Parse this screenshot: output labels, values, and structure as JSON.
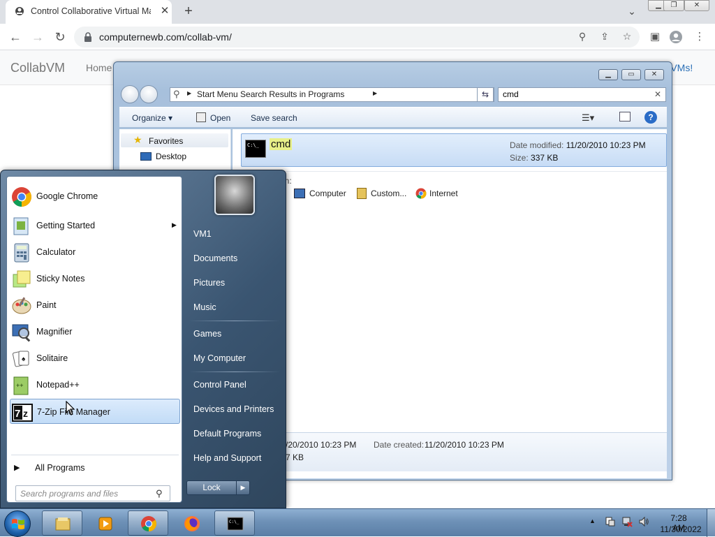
{
  "browser": {
    "tab_title": "Control Collaborative Virtual Ma",
    "tab_close": "✕",
    "new_tab": "+",
    "url": "computernewb.com/collab-vm/",
    "window_controls": {
      "minimize": "▁",
      "restore": "❐",
      "close": "✕"
    }
  },
  "site": {
    "brand": "CollabVM",
    "nav_home": "Home",
    "nav_more": "re VMs!"
  },
  "explorer": {
    "address": "Start Menu Search Results in Programs",
    "search_value": "cmd",
    "search_clear": "✕",
    "toolbar": {
      "organize": "Organize ▾",
      "open": "Open",
      "save_search": "Save search"
    },
    "nav_pane": {
      "favorites": "Favorites",
      "desktop": "Desktop"
    },
    "result": {
      "name": "cmd",
      "icon_text": "C:\\_",
      "date_modified_label": "Date modified:",
      "date_modified": "11/20/2010 10:23 PM",
      "size_label": "Size:",
      "size": "337 KB"
    },
    "search_again": {
      "label": "n in:",
      "items": [
        "s",
        "Computer",
        "Custom...",
        "Internet"
      ]
    },
    "details": {
      "date_modified_partial": "/20/2010 10:23 PM",
      "date_created_label": "Date created:",
      "date_created": "11/20/2010 10:23 PM",
      "size_partial": "7 KB"
    }
  },
  "start_menu": {
    "programs": [
      {
        "label": "Google Chrome",
        "icon": "chrome-icon"
      },
      {
        "label": "Getting Started",
        "icon": "getting-started-icon",
        "submenu": "▶"
      },
      {
        "label": "Calculator",
        "icon": "calculator-icon"
      },
      {
        "label": "Sticky Notes",
        "icon": "sticky-notes-icon"
      },
      {
        "label": "Paint",
        "icon": "paint-icon"
      },
      {
        "label": "Magnifier",
        "icon": "magnifier-icon"
      },
      {
        "label": "Solitaire",
        "icon": "solitaire-icon"
      },
      {
        "label": "Notepad++",
        "icon": "notepadpp-icon"
      },
      {
        "label": "7-Zip File Manager",
        "icon": "7zip-icon"
      }
    ],
    "all_programs": "All Programs",
    "search_placeholder": "Search programs and files",
    "right": [
      "VM1",
      "Documents",
      "Pictures",
      "Music",
      "Games",
      "My Computer",
      "Control Panel",
      "Devices and Printers",
      "Default Programs",
      "Help and Support"
    ],
    "lock": "Lock",
    "lock_arrow": "▶"
  },
  "taskbar": {
    "clock_time": "7:28 AM",
    "clock_date": "11/30/2022",
    "tray_arrow": "▲"
  },
  "colors": {
    "explorer_frame": "#a7c0dc",
    "start_menu": "#3a5571",
    "taskbar": "#6e91b7",
    "highlight": "#c2dcf7",
    "search_highlight": "#e8f089"
  }
}
